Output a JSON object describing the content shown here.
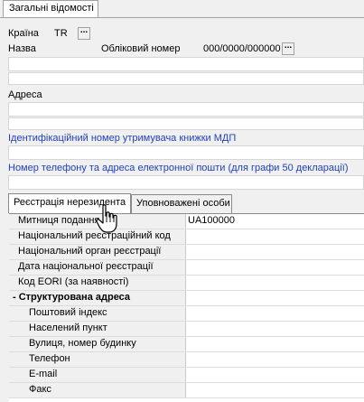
{
  "tabs_top": {
    "general": "Загальні відомості"
  },
  "country": {
    "label": "Країна",
    "value": "TR"
  },
  "name": {
    "label": "Назва"
  },
  "account": {
    "label": "Обліковий номер",
    "value": "000/0000/000000"
  },
  "address": {
    "label": "Адреса"
  },
  "tir_id": {
    "label": "Ідентифікаційний номер утримувача книжки МДП"
  },
  "phone_email": {
    "label": "Номер телефону та адреса електронної пошти (для графи 50 декларації)"
  },
  "lower_tabs": [
    {
      "label": "Реєстрація нерезидента",
      "active": true
    },
    {
      "label": "Уповноважені особи",
      "active": false
    }
  ],
  "grid": {
    "rows": [
      {
        "label": "Митниця подання",
        "value": "UA100000",
        "type": "top"
      },
      {
        "label": "Національний реєстраційний код",
        "value": "",
        "type": "top"
      },
      {
        "label": "Національний орган реєстрації",
        "value": "",
        "type": "top"
      },
      {
        "label": "Дата національної реєстрації",
        "value": "",
        "type": "top"
      },
      {
        "label": "Код EORI (за наявності)",
        "value": "",
        "type": "top"
      },
      {
        "label": "- Структурована адреса",
        "value": "",
        "type": "group"
      },
      {
        "label": "Поштовий індекс",
        "value": "",
        "type": "sub"
      },
      {
        "label": "Населений пункт",
        "value": "",
        "type": "sub"
      },
      {
        "label": "Вулиця, номер будинку",
        "value": "",
        "type": "sub"
      },
      {
        "label": "Телефон",
        "value": "",
        "type": "sub"
      },
      {
        "label": "E-mail",
        "value": "",
        "type": "sub"
      },
      {
        "label": "Факс",
        "value": "",
        "type": "sub"
      }
    ]
  },
  "icons": {
    "ellipsis": "ellipsis-icon",
    "cursor": "hand-cursor-icon"
  },
  "colors": {
    "blue_label": "#1f3fbf"
  }
}
